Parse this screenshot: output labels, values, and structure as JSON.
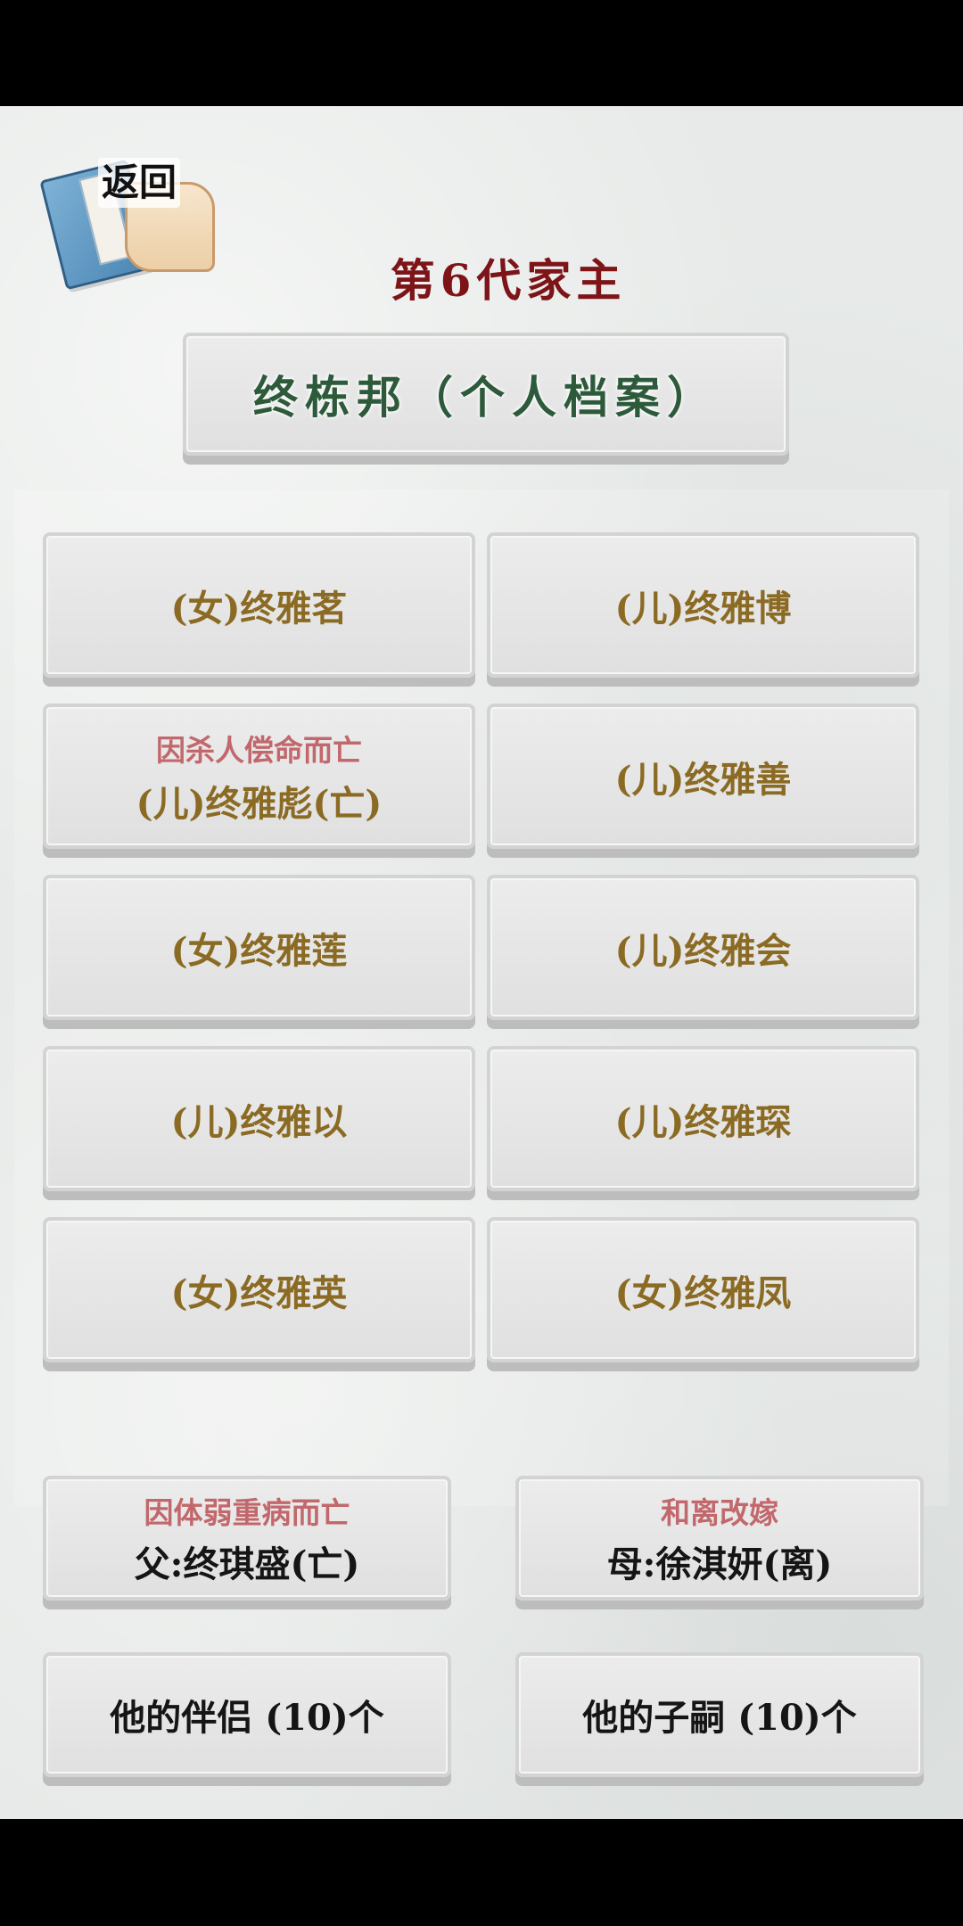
{
  "header": {
    "back_label": "返回",
    "generation_title": "第6代家主"
  },
  "profile": {
    "title": "终栋邦（个人档案）"
  },
  "children": [
    {
      "name": "(女)终雅茗",
      "note": ""
    },
    {
      "name": "(儿)终雅博",
      "note": ""
    },
    {
      "name": "(儿)终雅彪(亡)",
      "note": "因杀人偿命而亡"
    },
    {
      "name": "(儿)终雅善",
      "note": ""
    },
    {
      "name": "(女)终雅莲",
      "note": ""
    },
    {
      "name": "(儿)终雅会",
      "note": ""
    },
    {
      "name": "(儿)终雅以",
      "note": ""
    },
    {
      "name": "(儿)终雅琛",
      "note": ""
    },
    {
      "name": "(女)终雅英",
      "note": ""
    },
    {
      "name": "(女)终雅凤",
      "note": ""
    }
  ],
  "parents": {
    "father": {
      "name": "父:终琪盛(亡)",
      "note": "因体弱重病而亡"
    },
    "mother": {
      "name": "母:徐淇妍(离)",
      "note": "和离改嫁"
    }
  },
  "footer": {
    "partners_label": "他的伴侣 (10)个",
    "children_label": "他的子嗣 (10)个"
  }
}
